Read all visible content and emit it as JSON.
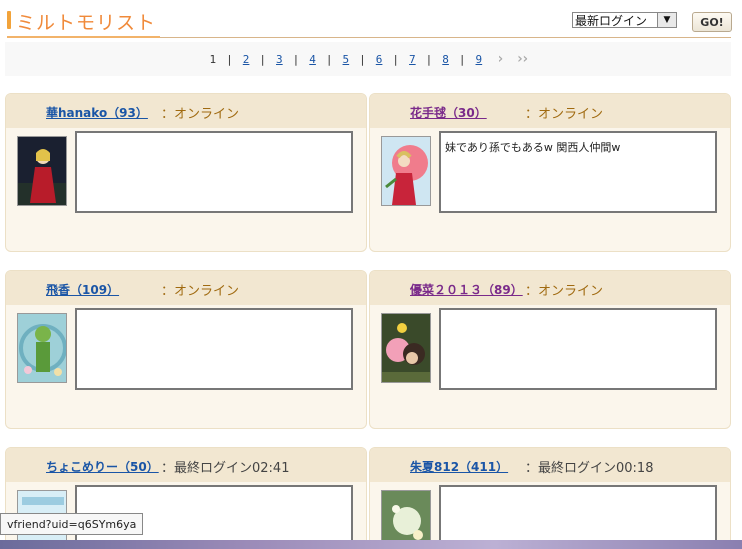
{
  "header": {
    "title": "ミルトモリスト",
    "sort_selected": "最新ログイン",
    "go_label": "GO!"
  },
  "pager": {
    "current": "1",
    "pages": [
      "2",
      "3",
      "4",
      "5",
      "6",
      "7",
      "8",
      "9"
    ],
    "next_label": "»",
    "last_label": "»»"
  },
  "cards": [
    {
      "name": "華hanako（93）",
      "status": "：オンライン",
      "comment": "",
      "name_color": "blue",
      "online": true
    },
    {
      "name": "花手毬（30）",
      "status": "：オンライン",
      "comment": "妹であり孫でもあるw 関西人仲間w",
      "name_color": "purple",
      "online": true
    },
    {
      "name": "飛香（109）",
      "status": "：オンライン",
      "comment": "",
      "name_color": "blue",
      "online": true
    },
    {
      "name": "優菜２０１３（89）",
      "status": "：オンライン",
      "comment": "",
      "name_color": "purple",
      "online": true
    },
    {
      "name": "ちょこめりー（50）",
      "status": "：最終ログイン02:41",
      "comment": "",
      "name_color": "blue",
      "online": false
    },
    {
      "name": "朱夏812（411）",
      "status": "：最終ログイン00:18",
      "comment": "",
      "name_color": "blue",
      "online": false
    }
  ],
  "status_bar": {
    "url_text": "vfriend?uid=q6SYm6ya"
  },
  "colors": {
    "accent_orange": "#f08a3a",
    "card_bg": "#fbf6ec",
    "card_head": "#f2e7d1",
    "link_blue": "#1a55a6",
    "link_purple": "#7a2a8a",
    "status_online": "#a06a10"
  }
}
